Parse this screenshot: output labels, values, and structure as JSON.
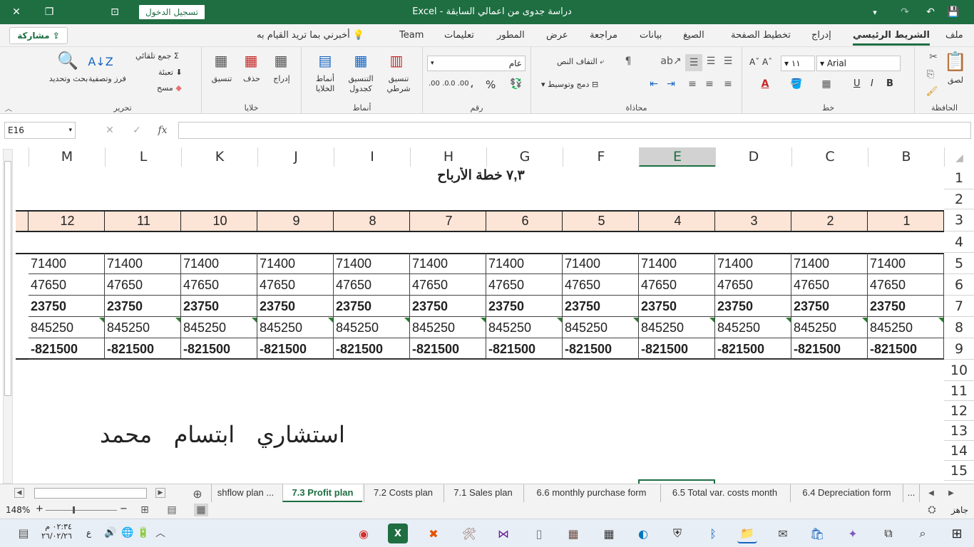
{
  "titlebar": {
    "title": "دراسة جدوى من اعمالي السابقة  -  Excel",
    "signin_label": "تسجيل الدخول"
  },
  "menu": {
    "tabs": [
      "ملف",
      "الشريط الرئيسي",
      "إدراج",
      "تخطيط الصفحة",
      "الصيغ",
      "بيانات",
      "مراجعة",
      "عرض",
      "المطور",
      "تعليمات",
      "Team"
    ],
    "tell_me": "أخبرني بما تريد القيام به",
    "share_label": "مشاركة"
  },
  "ribbon": {
    "clipboard": {
      "label": "الحافظة",
      "paste": "لصق"
    },
    "font": {
      "label": "خط",
      "font_name": "Arial",
      "font_size": "١١",
      "bold": "B",
      "italic": "I",
      "underline": "U"
    },
    "alignment": {
      "label": "محاذاة",
      "wrap_text": "التفاف النص",
      "merge": "دمج وتوسيط"
    },
    "number": {
      "label": "رقم",
      "format": "عام",
      "percent": "%",
      "comma": "،",
      "inc_dec": ".0 .00",
      "dec_dec": ".00 .0"
    },
    "styles": {
      "label": "أنماط",
      "conditional": "تنسيق شرطي",
      "as_table": "التنسيق كجدول",
      "cell_styles": "أنماط الخلايا"
    },
    "cells": {
      "label": "خلايا",
      "insert": "إدراج",
      "delete": "حذف",
      "format": "تنسيق"
    },
    "editing": {
      "label": "تحرير",
      "autosum": "جمع تلقائي",
      "fill": "تعبئة",
      "clear": "مسح",
      "sort": "فرز وتصفية",
      "find": "بحث وتحديد"
    }
  },
  "formula_bar": {
    "name_box": "E16",
    "fx": "fx",
    "value": ""
  },
  "sheet": {
    "columns": [
      "B",
      "C",
      "D",
      "E",
      "F",
      "G",
      "H",
      "I",
      "J",
      "K",
      "L",
      "M"
    ],
    "selected_column": "E",
    "rows": [
      "1",
      "2",
      "3",
      "4",
      "5",
      "6",
      "7",
      "8",
      "9",
      "10",
      "11",
      "12",
      "13",
      "14",
      "15"
    ],
    "title": "٧,٣ خطة الأرباح",
    "month_headers": [
      "1",
      "2",
      "3",
      "4",
      "5",
      "6",
      "7",
      "8",
      "9",
      "10",
      "11",
      "12"
    ],
    "data_rows": [
      {
        "values": [
          "71400",
          "71400",
          "71400",
          "71400",
          "71400",
          "71400",
          "71400",
          "71400",
          "71400",
          "71400",
          "71400",
          "71400"
        ],
        "bold": false,
        "flag": false
      },
      {
        "values": [
          "47650",
          "47650",
          "47650",
          "47650",
          "47650",
          "47650",
          "47650",
          "47650",
          "47650",
          "47650",
          "47650",
          "47650"
        ],
        "bold": false,
        "flag": false
      },
      {
        "values": [
          "23750",
          "23750",
          "23750",
          "23750",
          "23750",
          "23750",
          "23750",
          "23750",
          "23750",
          "23750",
          "23750",
          "23750"
        ],
        "bold": true,
        "flag": false
      },
      {
        "values": [
          "845250",
          "845250",
          "845250",
          "845250",
          "845250",
          "845250",
          "845250",
          "845250",
          "845250",
          "845250",
          "845250",
          "845250"
        ],
        "bold": false,
        "flag": true
      },
      {
        "values": [
          "-821500",
          "-821500",
          "-821500",
          "-821500",
          "-821500",
          "-821500",
          "-821500",
          "-821500",
          "-821500",
          "-821500",
          "-821500",
          "-821500"
        ],
        "bold": true,
        "flag": false
      }
    ],
    "signature": "استشاري   ابتسام   محمد"
  },
  "sheet_tabs": {
    "tabs": [
      "6.4 Depreciation form",
      "6.5 Total var. costs month",
      "6.6 monthly purchase form",
      "7.1 Sales plan",
      "7.2 Costs plan",
      "7.3 Profit plan",
      "shflow plan ..."
    ],
    "active": "7.3 Profit plan",
    "more": "..."
  },
  "status_bar": {
    "ready": "جاهز",
    "zoom": "148%"
  },
  "taskbar": {
    "time": "٠٢:٣٤ م",
    "date": "٢٦/٠٢/٢٦",
    "lang": "ع"
  },
  "colors": {
    "excel_green": "#1e6e42",
    "header_fill": "#fce4d6",
    "taskbar": "#e8eef5"
  }
}
